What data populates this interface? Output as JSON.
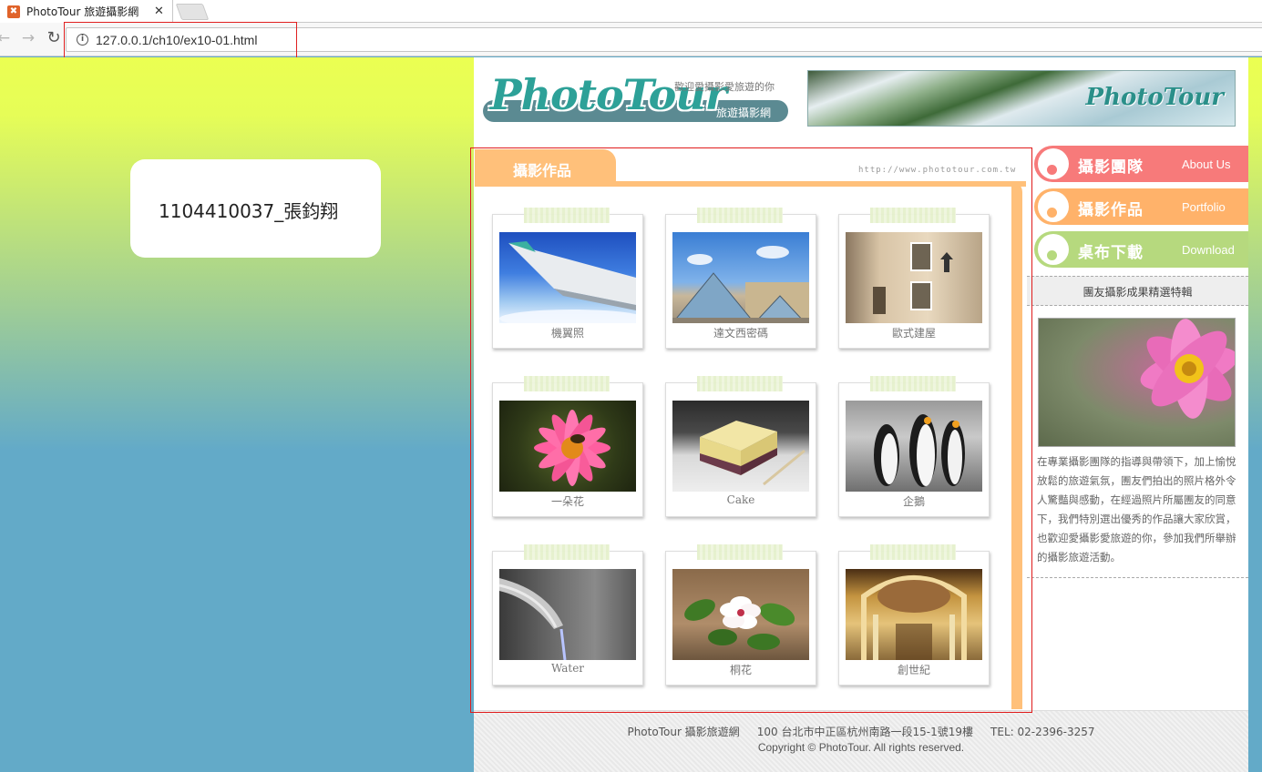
{
  "browser": {
    "tab_title": "PhotoTour 旅遊攝影網",
    "tab_close": "✕",
    "url": "127.0.0.1/ch10/ex10-01.html"
  },
  "student": {
    "name": "1104410037_張鈞翔"
  },
  "header": {
    "logo_text": "PhotoTour",
    "slogan": "歡迎愛攝影愛旅遊的你",
    "subtitle": "旅遊攝影網",
    "banner_logo": "PhotoTour"
  },
  "content": {
    "tab_label": "攝影作品",
    "url_text": "http://www.phototour.com.tw",
    "photos": [
      {
        "caption": "機翼照"
      },
      {
        "caption": "達文西密碼"
      },
      {
        "caption": "歐式建屋"
      },
      {
        "caption": "一朵花"
      },
      {
        "caption": "Cake"
      },
      {
        "caption": "企鵝"
      },
      {
        "caption": "Water"
      },
      {
        "caption": "桐花"
      },
      {
        "caption": "創世紀"
      }
    ]
  },
  "sidebar": {
    "menu": [
      {
        "zh": "攝影團隊",
        "en": "About Us",
        "color": "#f77a7a",
        "dot": "#f77a7a"
      },
      {
        "zh": "攝影作品",
        "en": "Portfolio",
        "color": "#ffb26a",
        "dot": "#ffb26a"
      },
      {
        "zh": "桌布下載",
        "en": "Download",
        "color": "#b6d97e",
        "dot": "#b6d97e"
      }
    ],
    "feature_title": "團友攝影成果精選特輯",
    "feature_desc": "在專業攝影團隊的指導與帶領下，加上愉悅放鬆的旅遊氣氛，團友們拍出的照片格外令人驚豔與感動，在經過照片所屬團友的同意下，我們特別選出優秀的作品讓大家欣賞，也歡迎愛攝影愛旅遊的你，參加我們所舉辦的攝影旅遊活動。"
  },
  "footer": {
    "line1": "PhotoTour 攝影旅遊網     100 台北市中正區杭州南路一段15-1號19樓     TEL: 02-2396-3257",
    "line2": "Copyright © PhotoTour. All rights reserved."
  }
}
